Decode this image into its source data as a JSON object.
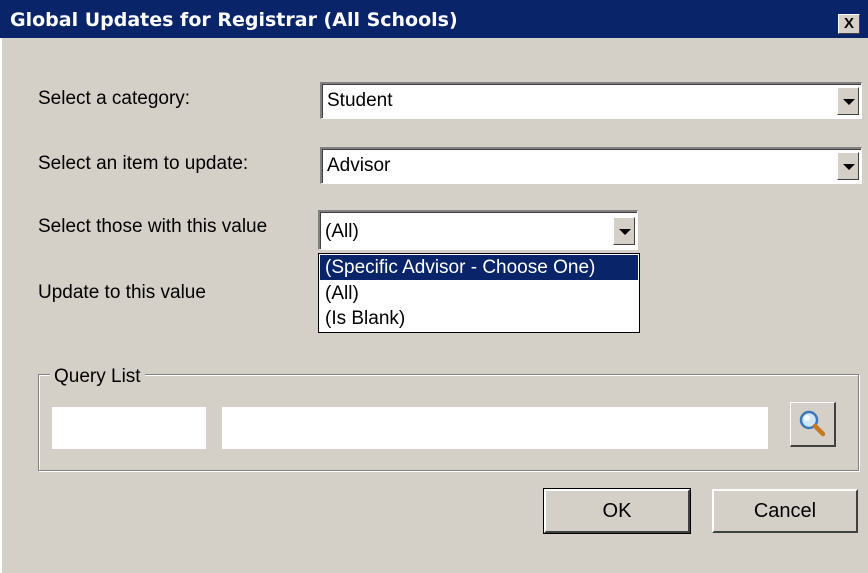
{
  "window": {
    "title": "Global Updates for Registrar (All Schools)",
    "close_glyph": "X"
  },
  "form": {
    "category_label": "Select a category:",
    "category_value": "Student",
    "item_label": "Select an item to update:",
    "item_value": "Advisor",
    "those_label": "Select those with this value",
    "those_value": "(All)",
    "update_label": "Update to this value"
  },
  "dropdown": {
    "options": [
      "(Specific Advisor - Choose One)",
      "(All)",
      "(Is Blank)"
    ],
    "selected_index": 0
  },
  "query_list": {
    "legend": "Query List",
    "search_icon": "magnifier-icon"
  },
  "buttons": {
    "ok_label": "OK",
    "cancel_label": "Cancel"
  },
  "colors": {
    "titlebar": "#0a246a",
    "dialog_bg": "#d4d0c8",
    "selection": "#0a246a"
  }
}
